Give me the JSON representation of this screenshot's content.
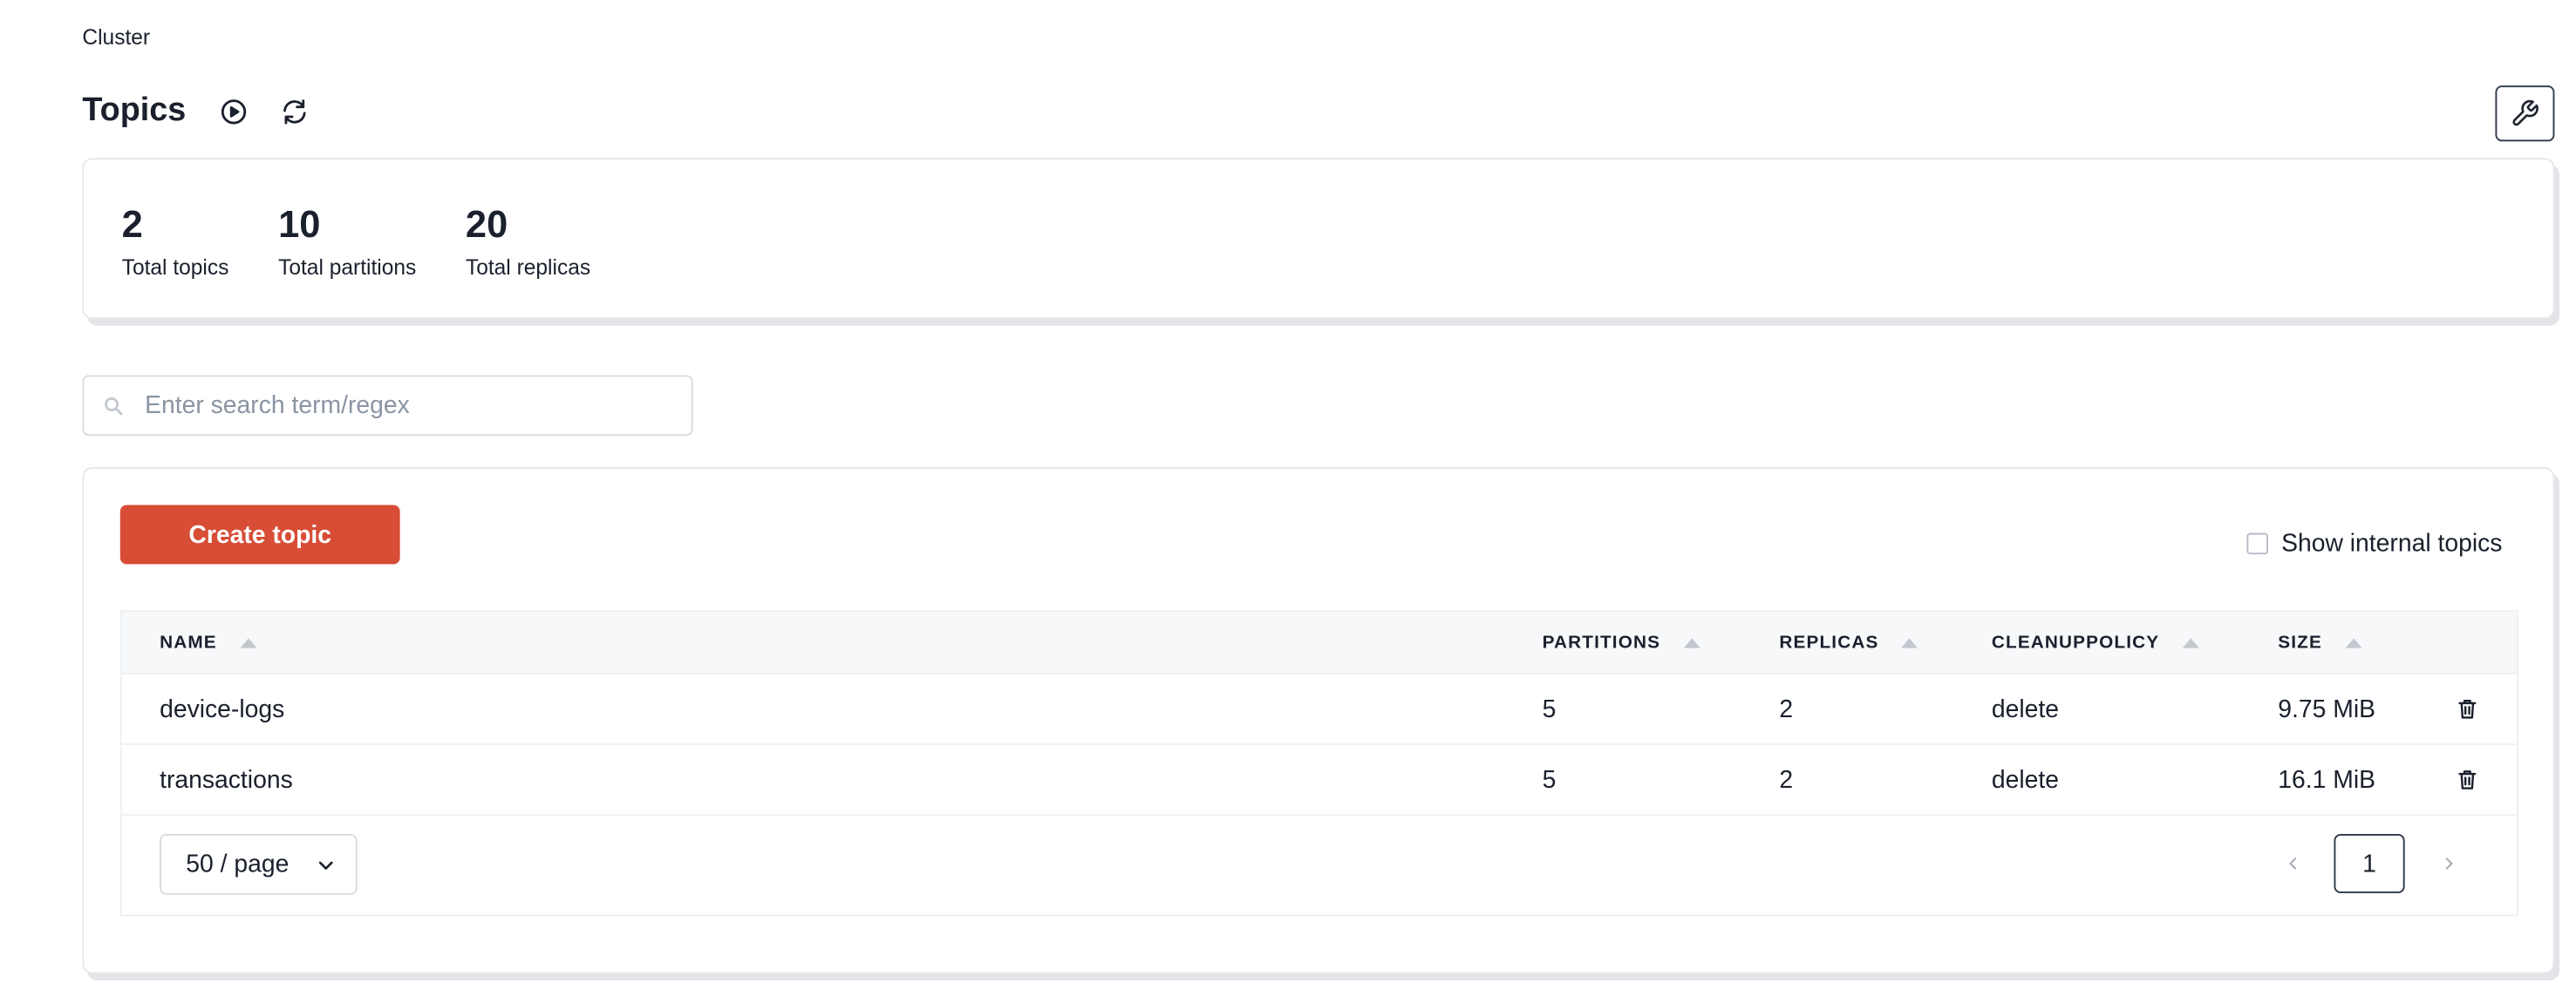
{
  "breadcrumb": {
    "label": "Cluster"
  },
  "header": {
    "title": "Topics"
  },
  "stats": [
    {
      "value": "2",
      "label": "Total topics"
    },
    {
      "value": "10",
      "label": "Total partitions"
    },
    {
      "value": "20",
      "label": "Total replicas"
    }
  ],
  "search": {
    "placeholder": "Enter search term/regex",
    "value": ""
  },
  "toolbar": {
    "create_label": "Create topic",
    "show_internal_label": "Show internal topics",
    "show_internal_checked": false
  },
  "table": {
    "columns": [
      "NAME",
      "PARTITIONS",
      "REPLICAS",
      "CLEANUPPOLICY",
      "SIZE"
    ],
    "rows": [
      {
        "name": "device-logs",
        "partitions": "5",
        "replicas": "2",
        "cleanup": "delete",
        "size": "9.75 MiB"
      },
      {
        "name": "transactions",
        "partitions": "5",
        "replicas": "2",
        "cleanup": "delete",
        "size": "16.1 MiB"
      }
    ]
  },
  "pagination": {
    "page_size_label": "50 / page",
    "current_page": "1"
  },
  "icons": {
    "run": "play-circle-icon",
    "refresh": "refresh-icon",
    "settings": "wrench-icon",
    "search": "search-icon",
    "delete": "trash-icon",
    "dropdown": "chevron-down-icon",
    "prev": "chevron-left-icon",
    "next": "chevron-right-icon"
  },
  "colors": {
    "accent": "#d74d36",
    "text": "#1a202c",
    "muted": "#8a94a3"
  }
}
